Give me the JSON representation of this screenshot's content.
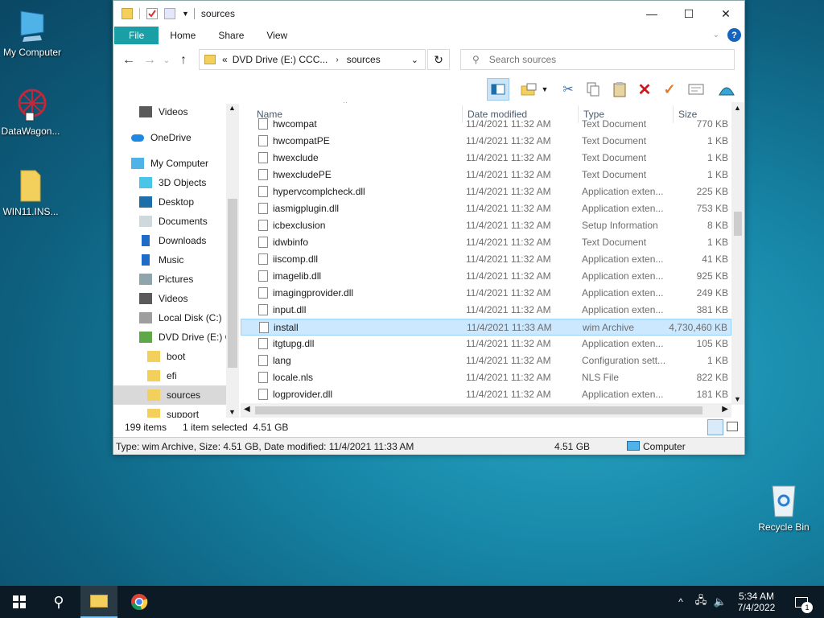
{
  "desktop": {
    "icons": [
      {
        "label": "My Computer"
      },
      {
        "label": "DataWagon..."
      },
      {
        "label": "WIN11.INS..."
      },
      {
        "label": "Recycle Bin"
      }
    ]
  },
  "window": {
    "title": "sources",
    "ribbon_tabs": [
      "File",
      "Home",
      "Share",
      "View"
    ],
    "address": {
      "overflow": "«",
      "path": [
        "DVD Drive (E:) CCC...",
        "sources"
      ],
      "search_placeholder": "Search sources"
    },
    "nav_items": [
      {
        "label": "Videos",
        "icon": "videos-icon"
      },
      {
        "label": "OneDrive",
        "icon": "onedrive-icon"
      },
      {
        "label": "My Computer",
        "icon": "computer-icon"
      },
      {
        "label": "3D Objects",
        "icon": "3d-objects-icon"
      },
      {
        "label": "Desktop",
        "icon": "desktop-folder-icon"
      },
      {
        "label": "Documents",
        "icon": "documents-icon"
      },
      {
        "label": "Downloads",
        "icon": "downloads-icon"
      },
      {
        "label": "Music",
        "icon": "music-icon"
      },
      {
        "label": "Pictures",
        "icon": "pictures-icon"
      },
      {
        "label": "Videos",
        "icon": "videos-icon"
      },
      {
        "label": "Local Disk (C:)",
        "icon": "disk-icon"
      },
      {
        "label": "DVD Drive (E:) C(",
        "icon": "dvd-icon"
      },
      {
        "label": "boot",
        "icon": "folder-icon"
      },
      {
        "label": "efi",
        "icon": "folder-icon"
      },
      {
        "label": "sources",
        "icon": "folder-icon"
      },
      {
        "label": "support",
        "icon": "folder-icon"
      }
    ],
    "columns": [
      "Name",
      "Date modified",
      "Type",
      "Size"
    ],
    "files": [
      {
        "name": "hwcompat",
        "date": "11/4/2021 11:32 AM",
        "type": "Text Document",
        "size": "770 KB"
      },
      {
        "name": "hwcompatPE",
        "date": "11/4/2021 11:32 AM",
        "type": "Text Document",
        "size": "1 KB"
      },
      {
        "name": "hwexclude",
        "date": "11/4/2021 11:32 AM",
        "type": "Text Document",
        "size": "1 KB"
      },
      {
        "name": "hwexcludePE",
        "date": "11/4/2021 11:32 AM",
        "type": "Text Document",
        "size": "1 KB"
      },
      {
        "name": "hypervcomplcheck.dll",
        "date": "11/4/2021 11:32 AM",
        "type": "Application exten...",
        "size": "225 KB"
      },
      {
        "name": "iasmigplugin.dll",
        "date": "11/4/2021 11:32 AM",
        "type": "Application exten...",
        "size": "753 KB"
      },
      {
        "name": "icbexclusion",
        "date": "11/4/2021 11:32 AM",
        "type": "Setup Information",
        "size": "8 KB"
      },
      {
        "name": "idwbinfo",
        "date": "11/4/2021 11:32 AM",
        "type": "Text Document",
        "size": "1 KB"
      },
      {
        "name": "iiscomp.dll",
        "date": "11/4/2021 11:32 AM",
        "type": "Application exten...",
        "size": "41 KB"
      },
      {
        "name": "imagelib.dll",
        "date": "11/4/2021 11:32 AM",
        "type": "Application exten...",
        "size": "925 KB"
      },
      {
        "name": "imagingprovider.dll",
        "date": "11/4/2021 11:32 AM",
        "type": "Application exten...",
        "size": "249 KB"
      },
      {
        "name": "input.dll",
        "date": "11/4/2021 11:32 AM",
        "type": "Application exten...",
        "size": "381 KB"
      },
      {
        "name": "install",
        "date": "11/4/2021 11:33 AM",
        "type": "wim Archive",
        "size": "4,730,460 KB"
      },
      {
        "name": "itgtupg.dll",
        "date": "11/4/2021 11:32 AM",
        "type": "Application exten...",
        "size": "105 KB"
      },
      {
        "name": "lang",
        "date": "11/4/2021 11:32 AM",
        "type": "Configuration sett...",
        "size": "1 KB"
      },
      {
        "name": "locale.nls",
        "date": "11/4/2021 11:32 AM",
        "type": "NLS File",
        "size": "822 KB"
      },
      {
        "name": "logprovider.dll",
        "date": "11/4/2021 11:32 AM",
        "type": "Application exten...",
        "size": "181 KB"
      }
    ],
    "status": {
      "item_count": "199 items",
      "selection": "1 item selected  4.51 GB"
    },
    "details": {
      "text": "Type: wim Archive, Size: 4.51 GB, Date modified: 11/4/2021 11:33 AM",
      "size": "4.51 GB",
      "location": "Computer"
    }
  },
  "taskbar": {
    "time": "5:34 AM",
    "date": "7/4/2022",
    "notification_count": "1"
  }
}
